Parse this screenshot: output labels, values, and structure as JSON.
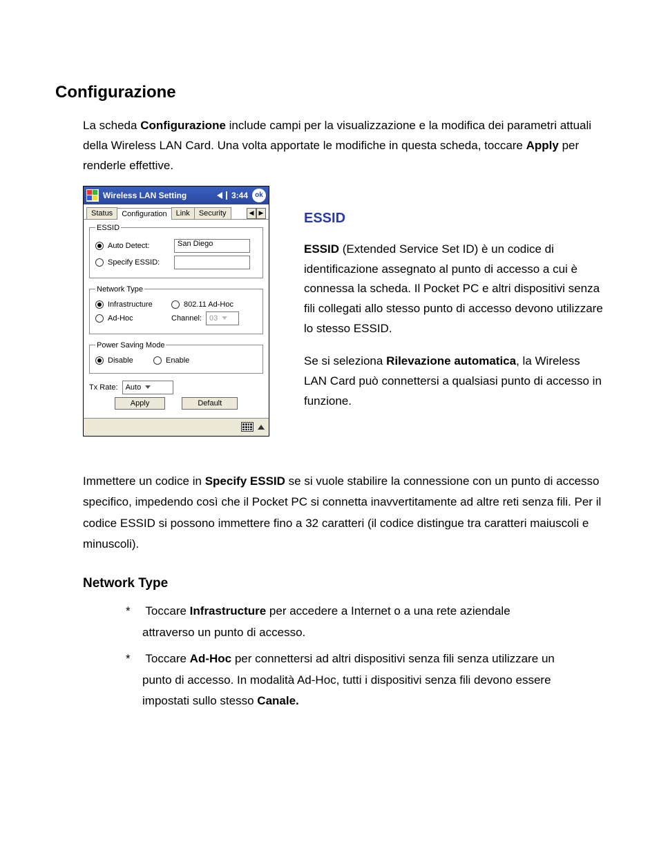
{
  "heading": "Configurazione",
  "intro": {
    "pre": "La scheda ",
    "b1": "Configurazione",
    "mid": " include campi per la visualizzazione e la modifica dei parametri attuali della Wireless LAN Card. Una volta apportate le modifiche in questa scheda, toccare ",
    "b2": "Apply",
    "post": " per renderle effettive."
  },
  "device": {
    "title": "Wireless LAN Setting",
    "clock": "3:44",
    "ok": "ok",
    "tabs": {
      "status": "Status",
      "config": "Configuration",
      "link": "Link",
      "security": "Security"
    },
    "essid": {
      "legend": "ESSID",
      "auto_label": "Auto Detect:",
      "auto_value": "San Diego",
      "specify_label": "Specify ESSID:",
      "specify_value": ""
    },
    "nettype": {
      "legend": "Network Type",
      "infra": "Infrastructure",
      "wadhoc": "802.11 Ad-Hoc",
      "adhoc": "Ad-Hoc",
      "channel_label": "Channel:",
      "channel_value": "03"
    },
    "psm": {
      "legend": "Power Saving Mode",
      "disable": "Disable",
      "enable": "Enable"
    },
    "txrate_label": "Tx Rate:",
    "txrate_value": "Auto",
    "apply": "Apply",
    "default": "Default"
  },
  "essid_section": {
    "title": "ESSID",
    "p1_b": "ESSID",
    "p1_rest": " (Extended Service Set ID) è un codice di identificazione assegnato al punto di accesso a cui è connessa la scheda. Il Pocket PC e altri dispositivi senza fili collegati allo stesso punto di accesso devono utilizzare lo stesso ESSID.",
    "p2_pre": "Se si seleziona ",
    "p2_b": "Rilevazione automatica",
    "p2_post": ", la Wireless LAN Card può connettersi a qualsiasi punto di accesso in funzione."
  },
  "para_after": {
    "pre": "Immettere un codice in ",
    "b": "Specify ESSID",
    "post": " se si vuole stabilire la connessione con un punto di accesso specifico, impedendo così che il Pocket PC si connetta inavvertitamente ad altre reti senza fili. Per il codice ESSID si possono immettere fino a 32 caratteri (il codice distingue tra caratteri maiuscoli e minuscoli)."
  },
  "nettype_section": {
    "title": "Network Type",
    "li1_pre": "Toccare ",
    "li1_b": "Infrastructure",
    "li1_post": " per accedere a Internet o a una rete aziendale attraverso un punto di accesso.",
    "li2_pre": "Toccare ",
    "li2_b": "Ad-Hoc",
    "li2_mid": " per connettersi ad altri dispositivi senza fili senza utilizzare un punto di accesso. In modalità Ad-Hoc, tutti i dispositivi senza fili devono essere impostati sullo stesso ",
    "li2_b2": "Canale."
  }
}
